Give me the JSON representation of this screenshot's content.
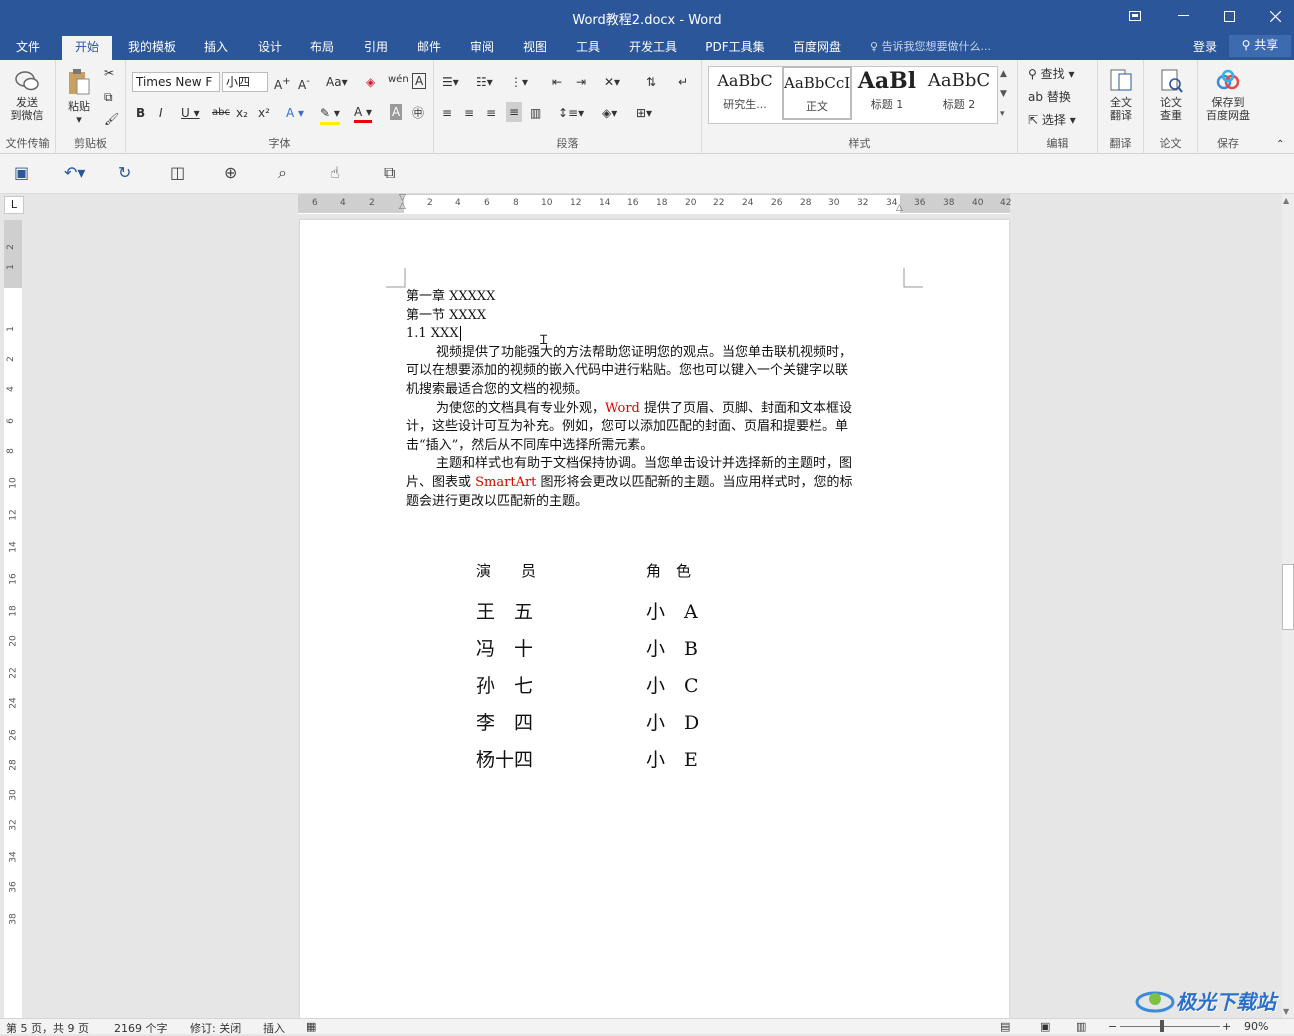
{
  "window": {
    "title": "Word教程2.docx - Word"
  },
  "tabs": [
    "文件",
    "开始",
    "我的模板",
    "插入",
    "设计",
    "布局",
    "引用",
    "邮件",
    "审阅",
    "视图",
    "工具",
    "开发工具",
    "PDF工具集",
    "百度网盘"
  ],
  "tellme": "告诉我您想要做什么...",
  "login": "登录",
  "share": "共享",
  "ribbon": {
    "wechat": {
      "label1": "发送",
      "label2": "到微信",
      "group": "文件传输"
    },
    "clipboard": {
      "paste": "粘贴",
      "group": "剪贴板"
    },
    "font": {
      "name": "Times New F",
      "size": "小四",
      "group": "字体"
    },
    "paragraph": {
      "group": "段落"
    },
    "styles": {
      "group": "样式",
      "items": [
        {
          "sample": "AaBbC",
          "name": "研究生..."
        },
        {
          "sample": "AaBbCcI",
          "name": "正文"
        },
        {
          "sample": "AaBl",
          "name": "标题 1"
        },
        {
          "sample": "AaBbC",
          "name": "标题 2"
        }
      ]
    },
    "edit": {
      "find": "查找",
      "replace": "替换",
      "select": "选择",
      "group": "编辑"
    },
    "translate": {
      "label1": "全文",
      "label2": "翻译",
      "group": "翻译"
    },
    "thesis": {
      "label1": "论文",
      "label2": "查重",
      "group": "论文"
    },
    "save": {
      "label1": "保存到",
      "label2": "百度网盘",
      "group": "保存"
    }
  },
  "ruler": {
    "h_labels": [
      "6",
      "4",
      "2",
      "2",
      "4",
      "6",
      "8",
      "10",
      "12",
      "14",
      "16",
      "18",
      "20",
      "22",
      "24",
      "26",
      "28",
      "30",
      "32",
      "34",
      "36",
      "38",
      "40",
      "42"
    ],
    "v_labels": [
      "2",
      "1",
      "1",
      "2",
      "4",
      "6",
      "8",
      "10",
      "12",
      "14",
      "16",
      "18",
      "20",
      "22",
      "24",
      "26",
      "28",
      "30",
      "32",
      "34",
      "36",
      "38"
    ]
  },
  "document": {
    "lines": [
      "第一章  XXXXX",
      "第一节  XXXX",
      "1.1 XXX"
    ],
    "p1": [
      "视频提供了功能强大的方法帮助您证明您的观点。当您单击联机视频时，",
      "可以在想要添加的视频的嵌入代码中进行粘贴。您也可以键入一个关键字以联",
      "机搜索最适合您的文档的视频。"
    ],
    "p2": {
      "a": "为使您的文档具有专业外观，",
      "word": "Word",
      "b": " 提供了页眉、页脚、封面和文本框设",
      "l2": "计，这些设计可互为补充。例如，您可以添加匹配的封面、页眉和提要栏。单",
      "l3": "击“插入”，然后从不同库中选择所需元素。"
    },
    "p3": {
      "l1": "主题和样式也有助于文档保持协调。当您单击设计并选择新的主题时，图",
      "a": "片、图表或 ",
      "smartart": "SmartArt",
      "b": " 图形将会更改以匹配新的主题。当应用样式时，您的标",
      "l3": "题会进行更改以匹配新的主题。"
    },
    "table": {
      "headers": [
        "演　　员",
        "角　色"
      ],
      "rows": [
        [
          "王　五",
          "小　A"
        ],
        [
          "冯　十",
          "小　B"
        ],
        [
          "孙　七",
          "小　C"
        ],
        [
          "李　四",
          "小　D"
        ],
        [
          "杨十四",
          "小　E"
        ]
      ]
    }
  },
  "status": {
    "page": "第 5 页，共 9 页",
    "words": "2169 个字",
    "track": "修订: 关闭",
    "insert": "插入",
    "zoom": "90%"
  },
  "watermark": "极光下载站"
}
